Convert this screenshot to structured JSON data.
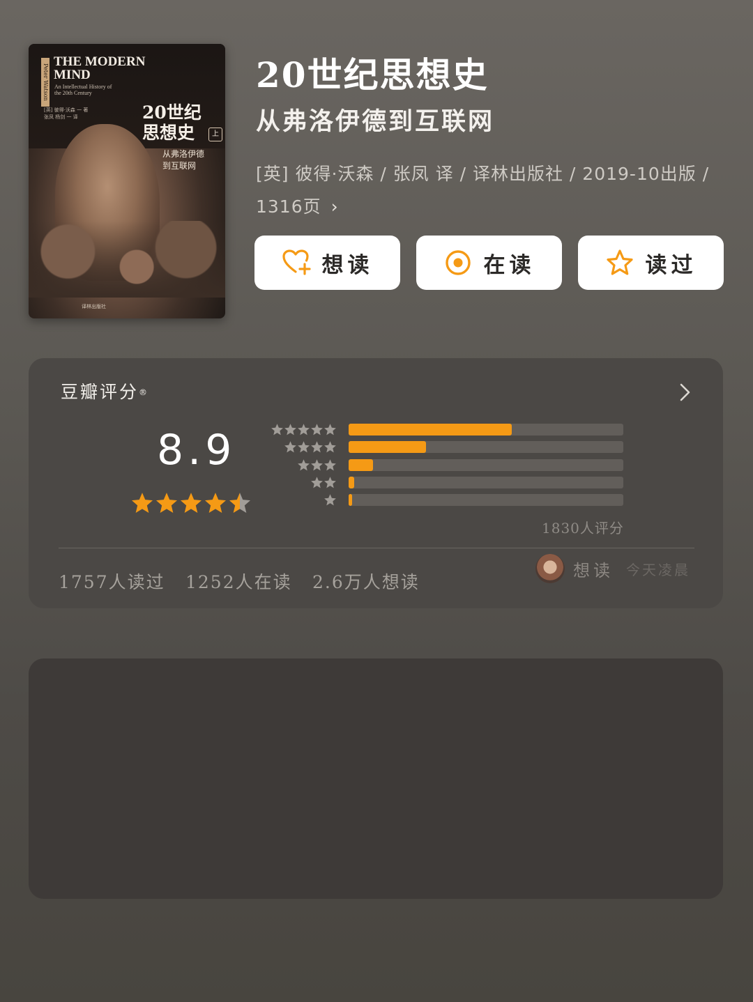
{
  "book": {
    "cover": {
      "spine_label": "Peter Watson",
      "en_title": "THE MODERN\nMIND",
      "en_subtitle": "An Intellectual History of\nthe 20th Century",
      "translators": "[英] 彼得·沃森 一 著\n张凤 杨剑 一 译",
      "zh_title": "20世纪\n思想史",
      "volume": "上",
      "zh_subtitle": "从弗洛伊德\n到互联网",
      "publisher_mark": "译林出版社"
    },
    "title": "20世纪思想史",
    "subtitle": "从弗洛伊德到互联网",
    "meta": "[英] 彼得·沃森 / 张凤 译 / 译林出版社 / 2019-10出版 / 1316页",
    "meta_chevron": "›"
  },
  "actions": {
    "want_label": "想读",
    "reading_label": "在读",
    "read_label": "读过"
  },
  "rating": {
    "label": "豆瓣评分",
    "registered": "®",
    "score": "8.9",
    "score_stars": 4.5,
    "distribution": [
      {
        "stars": 5,
        "fraction": 0.595
      },
      {
        "stars": 4,
        "fraction": 0.282
      },
      {
        "stars": 3,
        "fraction": 0.09
      },
      {
        "stars": 2,
        "fraction": 0.02
      },
      {
        "stars": 1,
        "fraction": 0.008
      }
    ],
    "count_text": "1830人评分",
    "stats": {
      "read": "1757人读过",
      "reading": "1252人在读",
      "want": "2.6万人想读"
    },
    "activity": {
      "verb": "想读",
      "time": "今天凌晨"
    }
  },
  "colors": {
    "accent": "#f59a15",
    "track": "#625e5a",
    "star_empty": "#a19d98"
  }
}
